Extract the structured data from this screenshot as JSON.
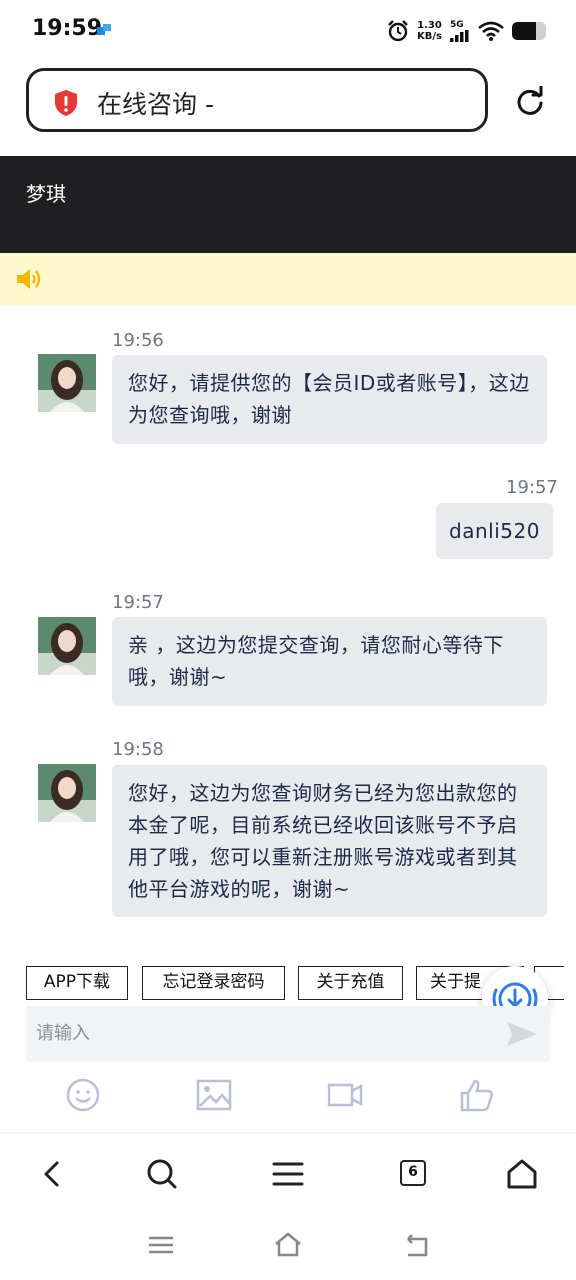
{
  "status": {
    "time": "19:59",
    "net_speed_value": "1.30",
    "net_speed_unit": "KB/s",
    "network": "5G",
    "battery_level": 0.7
  },
  "browser": {
    "url_text": "在线咨询 -",
    "tab_count": "6"
  },
  "chat": {
    "agent_name": "梦琪",
    "messages": [
      {
        "side": "left",
        "time": "19:56",
        "text": "您好，请提供您的【会员ID或者账号】，这边为您查询哦，谢谢"
      },
      {
        "side": "right",
        "time": "19:57",
        "text": "danli520"
      },
      {
        "side": "left",
        "time": "19:57",
        "text": "亲 ，这边为您提交查询，请您耐心等待下哦，谢谢~"
      },
      {
        "side": "left",
        "time": "19:58",
        "text": "您好，这边为您查询财务已经为您出款您的本金了呢，目前系统已经收回该账号不予启用了哦，您可以重新注册账号游戏或者到其他平台游戏的呢，谢谢~"
      }
    ],
    "quick_buttons": [
      "APP下载",
      "忘记登录密码",
      "关于充值",
      "关于提"
    ],
    "input_placeholder": "请输入"
  },
  "icons": {
    "tools": [
      "emoji-icon",
      "image-icon",
      "video-icon",
      "thumbs-up-icon"
    ],
    "browser_nav": [
      "back-icon",
      "search-icon",
      "menu-icon",
      "tabs-icon",
      "home-icon"
    ],
    "system_nav": [
      "recents-icon",
      "home-icon",
      "back-icon"
    ]
  },
  "colors": {
    "header_bg": "#1f1f21",
    "notice_bg": "#fff8cf",
    "bubble_bg": "#e9eaed",
    "bubble_text": "#1c2a4a",
    "fab_accent": "#2f7de1",
    "shield": "#e53935"
  }
}
